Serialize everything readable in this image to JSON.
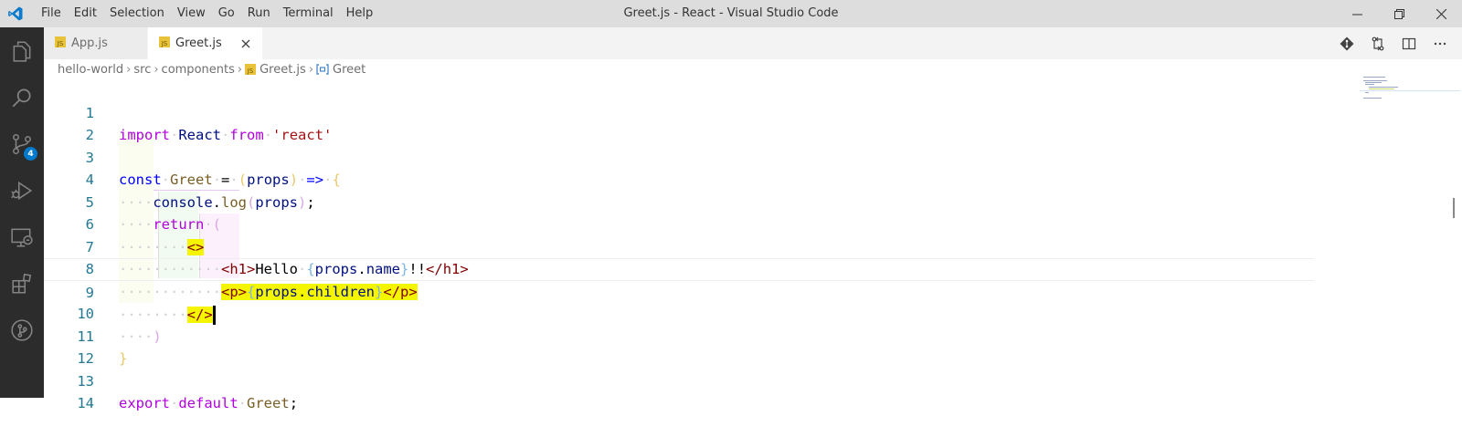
{
  "app": {
    "window_title": "Greet.js - React - Visual Studio Code",
    "accent": "#007acc"
  },
  "menu": [
    "File",
    "Edit",
    "Selection",
    "View",
    "Go",
    "Run",
    "Terminal",
    "Help"
  ],
  "activity_bar": {
    "items": [
      "files-icon",
      "search-icon",
      "source-control-icon",
      "run-debug-icon",
      "remote-explorer-icon",
      "extensions-icon",
      "git-graph-icon"
    ],
    "source_control_badge": "4"
  },
  "tabs": [
    {
      "label": "App.js",
      "active": false
    },
    {
      "label": "Greet.js",
      "active": true
    }
  ],
  "breadcrumb": [
    "hello-world",
    "src",
    "components",
    "Greet.js",
    "Greet"
  ],
  "editor": {
    "line_numbers": [
      "1",
      "2",
      "3",
      "4",
      "5",
      "6",
      "7",
      "8",
      "9",
      "10",
      "11",
      "12",
      "13",
      "14"
    ],
    "current_line": 9,
    "lines": [
      "import React from 'react'",
      "",
      "const Greet = (props) => {",
      "    console.log(props);",
      "    return (",
      "        <>",
      "            <h1>Hello {props.name}!!</h1>",
      "            <p>{props.children}</p>",
      "        </>",
      "    )",
      "}",
      "",
      "export default Greet;",
      ""
    ]
  }
}
